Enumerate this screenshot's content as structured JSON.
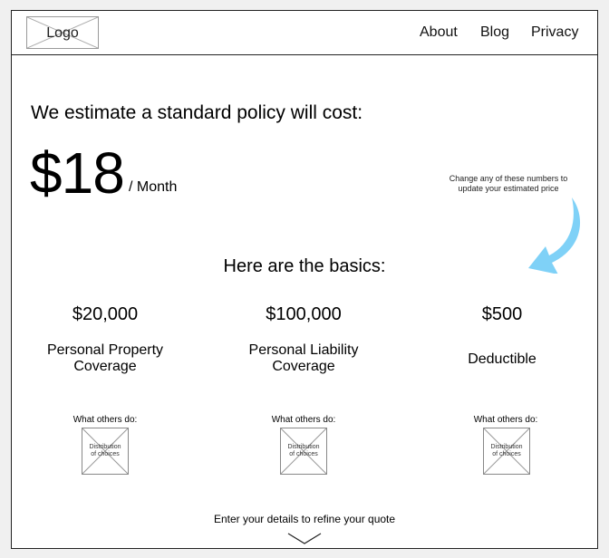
{
  "header": {
    "logo": "Logo",
    "nav": [
      "About",
      "Blog",
      "Privacy"
    ]
  },
  "estimate": {
    "headline": "We estimate a standard policy will cost:",
    "price": "$18",
    "period": "/ Month"
  },
  "hint": {
    "line1": "Change any of these numbers to",
    "line2": "update your estimated price",
    "arrow_color": "#7fd1f7"
  },
  "basics": {
    "title": "Here are the basics:",
    "items": [
      {
        "value": "$20,000",
        "label_line1": "Personal Property",
        "label_line2": "Coverage",
        "others": "What others do:",
        "placeholder_line1": "Distribution",
        "placeholder_line2": "of choices"
      },
      {
        "value": "$100,000",
        "label_line1": "Personal Liability",
        "label_line2": "Coverage",
        "others": "What others do:",
        "placeholder_line1": "Distribution",
        "placeholder_line2": "of choices"
      },
      {
        "value": "$500",
        "label_line1": "Deductible",
        "label_line2": "",
        "others": "What others do:",
        "placeholder_line1": "Distribution",
        "placeholder_line2": "of choices"
      }
    ]
  },
  "footer": {
    "refine": "Enter your details to refine your quote",
    "chevron_icon": "chevron-down-icon"
  }
}
